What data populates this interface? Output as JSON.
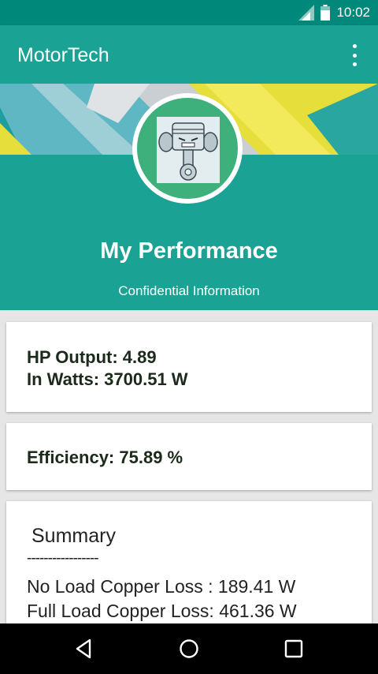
{
  "status_bar": {
    "time": "10:02"
  },
  "app_bar": {
    "title": "MotorTech"
  },
  "header": {
    "title": "My Performance",
    "subtitle": "Confidential Information"
  },
  "hp_card": {
    "hp_output": "HP Output: 4.89",
    "in_watts": "In Watts: 3700.51 W"
  },
  "efficiency_card": {
    "efficiency": "Efficiency: 75.89 %"
  },
  "summary_card": {
    "title": "Summary",
    "divider": "-----------------",
    "no_load_copper_loss": "No Load Copper Loss : 189.41 W",
    "full_load_copper_loss": "Full Load Copper Loss: 461.36 W"
  },
  "icons": {
    "signal": "signal-icon",
    "battery": "battery-icon",
    "overflow": "more-vert-icon",
    "avatar": "piston-mascot-icon",
    "back": "back-icon",
    "home": "home-icon",
    "recents": "recents-icon"
  },
  "colors": {
    "status_bar": "#00897b",
    "primary": "#1aa394",
    "avatar_bg": "#3db07b",
    "banner_yellow": "#e6de3a"
  }
}
